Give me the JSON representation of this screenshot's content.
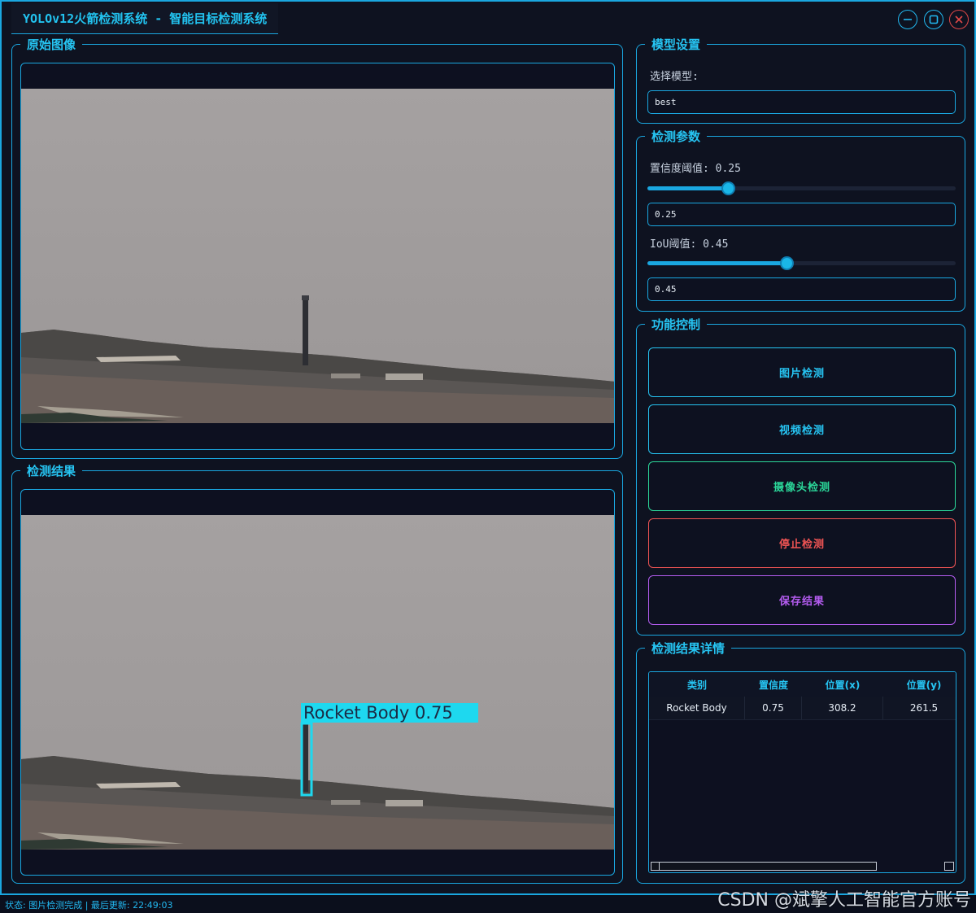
{
  "window": {
    "title": "YOLOv12火箭检测系统 - 智能目标检测系统"
  },
  "original_image": {
    "title": "原始图像"
  },
  "detection_result": {
    "title": "检测结果",
    "box_label": "Rocket Body 0.75"
  },
  "model_settings": {
    "title": "模型设置",
    "select_label": "选择模型:",
    "model_value": "best"
  },
  "detection_params": {
    "title": "检测参数",
    "confidence_label": "置信度阈值: 0.25",
    "confidence_value": "0.25",
    "confidence_level": 0.25,
    "iou_label": "IoU阈值: 0.45",
    "iou_value": "0.45",
    "iou_level": 0.45
  },
  "function_control": {
    "title": "功能控制",
    "buttons": [
      {
        "label": "图片检测",
        "color": "#26c4f2"
      },
      {
        "label": "视频检测",
        "color": "#26c4f2"
      },
      {
        "label": "摄像头检测",
        "color": "#2bd89a"
      },
      {
        "label": "停止检测",
        "color": "#f05454"
      },
      {
        "label": "保存结果",
        "color": "#b45cf0"
      }
    ]
  },
  "result_details": {
    "title": "检测结果详情",
    "columns": [
      "类别",
      "置信度",
      "位置(x)",
      "位置(y)"
    ],
    "rows": [
      [
        "Rocket Body",
        "0.75",
        "308.2",
        "261.5"
      ]
    ]
  },
  "status": {
    "text": "状态: 图片检测完成 | 最后更新: 22:49:03"
  },
  "watermark": "CSDN @斌擎人工智能官方账号",
  "colors": {
    "accent": "#1aa7e0",
    "detection_box": "#1ed8ef"
  }
}
